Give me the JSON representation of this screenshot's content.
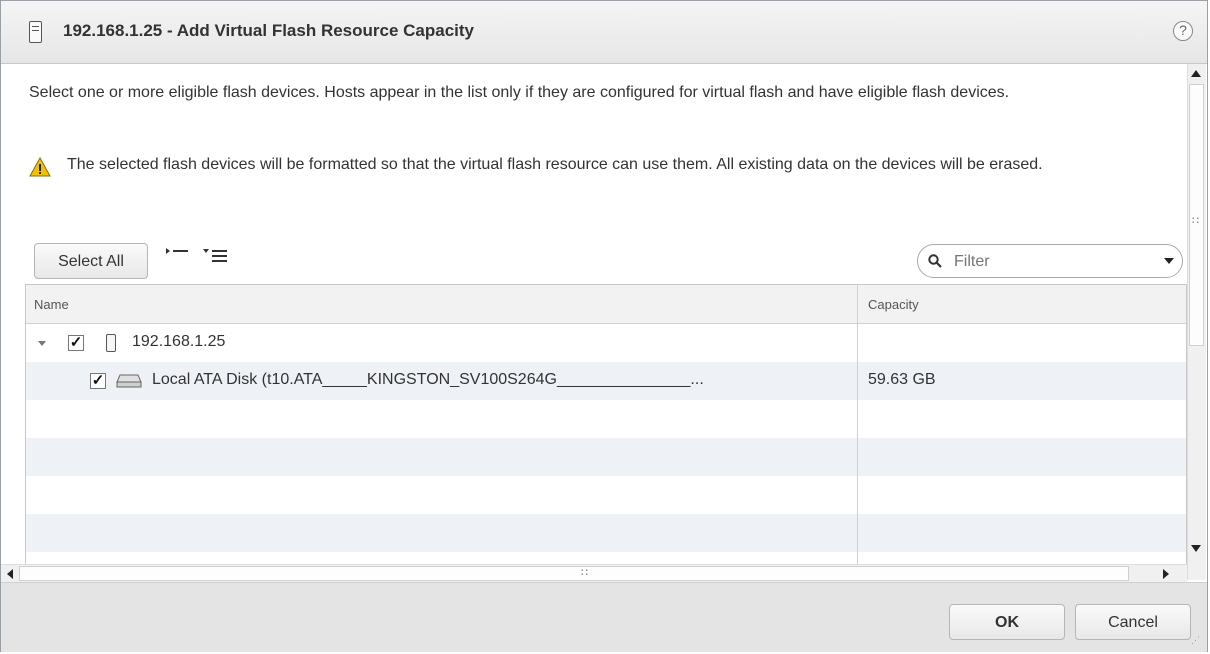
{
  "dialog": {
    "title": "192.168.1.25 - Add Virtual Flash Resource Capacity",
    "help_icon": "?",
    "description": "Select one or more eligible flash devices. Hosts appear in the list only if they are configured for virtual flash and have eligible flash devices.",
    "warning": "The selected flash devices will be formatted so that the virtual flash resource can use them. All existing data on the devices will be erased."
  },
  "toolbar": {
    "select_all_label": "Select All",
    "expand_all_icon": "expand-all-icon",
    "collapse_all_icon": "collapse-all-icon",
    "filter_placeholder": "Filter"
  },
  "grid": {
    "columns": [
      "Name",
      "Capacity"
    ],
    "rows": [
      {
        "name": "192.168.1.25",
        "capacity": "",
        "checked": true,
        "type": "host"
      },
      {
        "name": "Local ATA Disk (t10.ATA_____KINGSTON_SV100S264G_______________...",
        "capacity": "59.63 GB",
        "checked": true,
        "type": "disk"
      }
    ]
  },
  "footer": {
    "ok_label": "OK",
    "cancel_label": "Cancel"
  },
  "colors": {
    "warning": "#f2c200",
    "title_bar": "#eaeaea",
    "row_alt": "#eef2f6"
  }
}
